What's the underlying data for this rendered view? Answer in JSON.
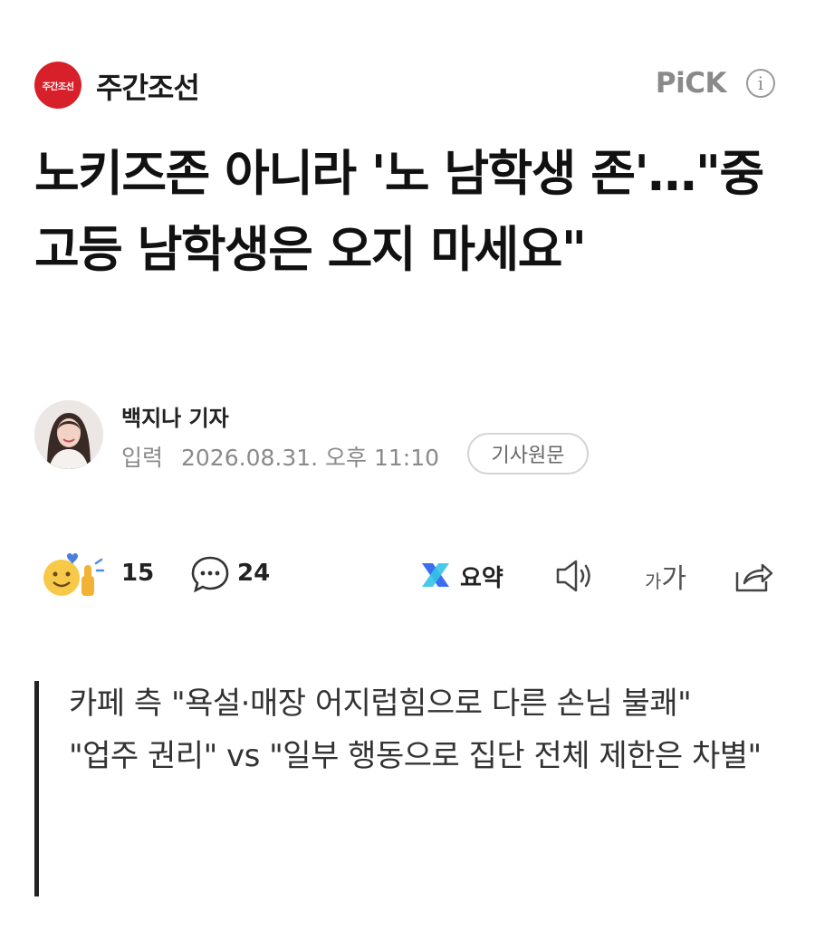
{
  "header": {
    "logo_text": "주간조선",
    "press_name": "주간조선",
    "pick_label": "PiCK",
    "info_icon": "info-icon",
    "brand_color": "#d8202a"
  },
  "headline": "노키즈존 아니라 '노 남학생 존'…\"중고등 남학생은 오지 마세요\"",
  "byline": {
    "author": "백지나 기자",
    "date_label": "입력",
    "date_value": "2026.08.31. 오후 11:10",
    "original_button": "기사원문"
  },
  "actions": {
    "reaction_count": "15",
    "comment_count": "24",
    "summary_label": "요약",
    "font_size_small": "가",
    "font_size_large": "가",
    "icons": [
      "reaction-emoji-icon",
      "comment-icon",
      "summary-icon",
      "speaker-icon",
      "font-size-icon",
      "share-icon"
    ]
  },
  "subtitle": {
    "line1": "카페 측 \"욕설·매장 어지럽힘으로 다른 손님 불쾌\"",
    "line2": "\"업주 권리\" vs \"일부 행동으로 집단 전체 제한은 차별\""
  }
}
